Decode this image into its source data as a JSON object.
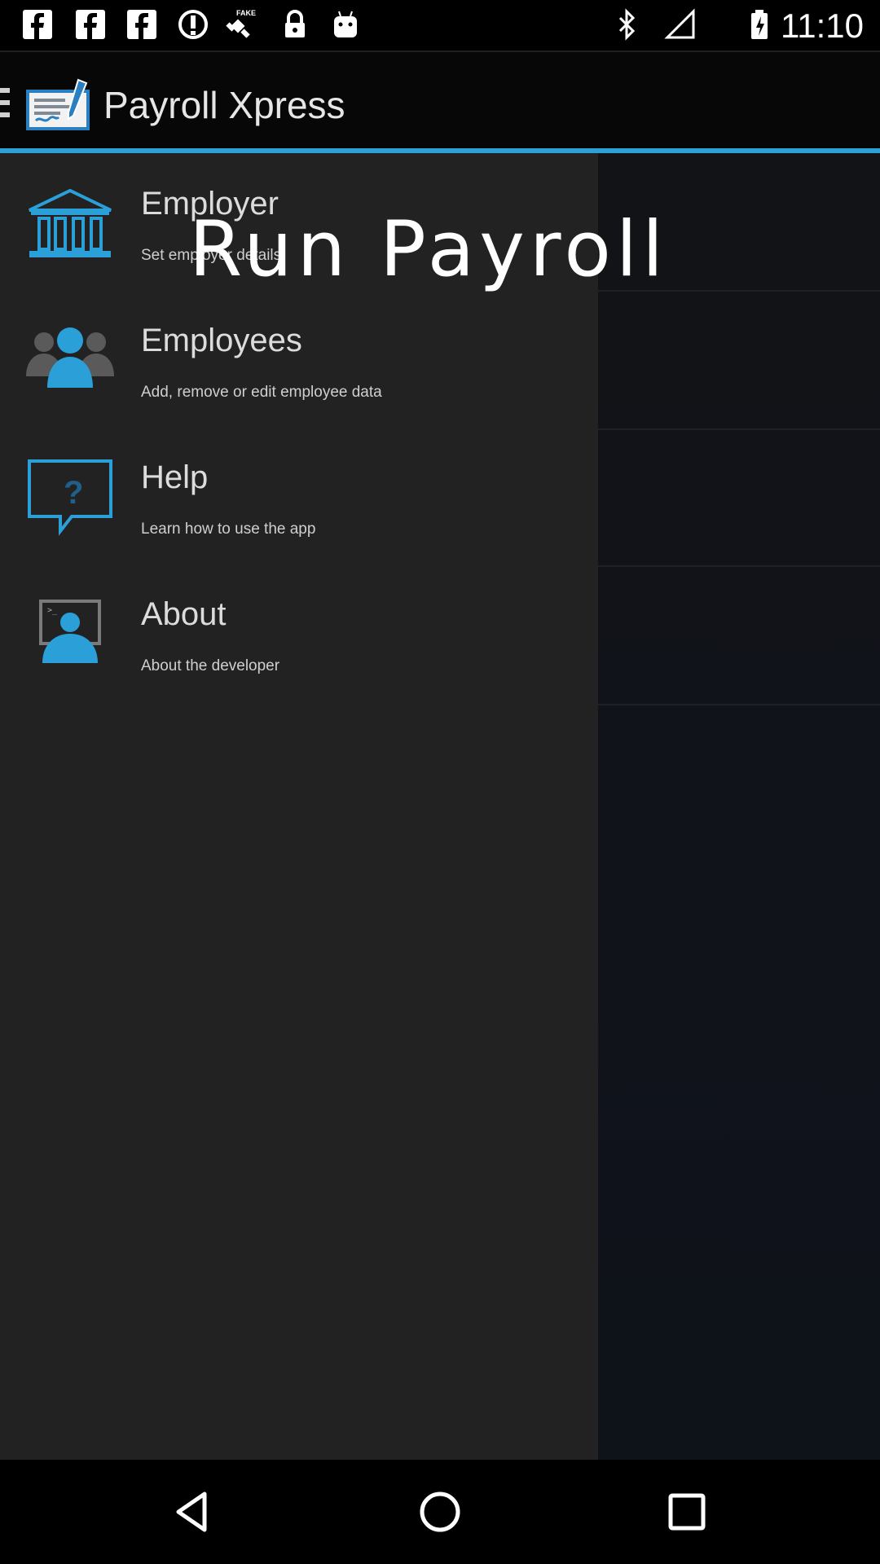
{
  "status_bar": {
    "time": "11:10",
    "left_icons": [
      "facebook-icon",
      "facebook-icon",
      "facebook-icon",
      "alert-circle-icon",
      "fake-gps-satellite-icon",
      "lock-icon",
      "android-icon"
    ],
    "right_icons": [
      "bluetooth-icon",
      "no-signal-icon",
      "battery-icon"
    ]
  },
  "action_bar": {
    "title": "Payroll Xpress",
    "accent_color": "#2ea0d8"
  },
  "main": {
    "overlay_text": "Run Payroll"
  },
  "drawer": {
    "items": [
      {
        "title": "Employer",
        "subtitle": "Set employer details",
        "icon": "bank-building-icon"
      },
      {
        "title": "Employees",
        "subtitle": "Add, remove or edit employee data",
        "icon": "people-group-icon"
      },
      {
        "title": "Help",
        "subtitle": "Learn how to use the app",
        "icon": "help-question-bubble-icon"
      },
      {
        "title": "About",
        "subtitle": "About the developer",
        "icon": "developer-monitor-icon"
      }
    ]
  },
  "nav_bar": {
    "buttons": [
      "back-icon",
      "home-icon",
      "recents-icon"
    ]
  }
}
